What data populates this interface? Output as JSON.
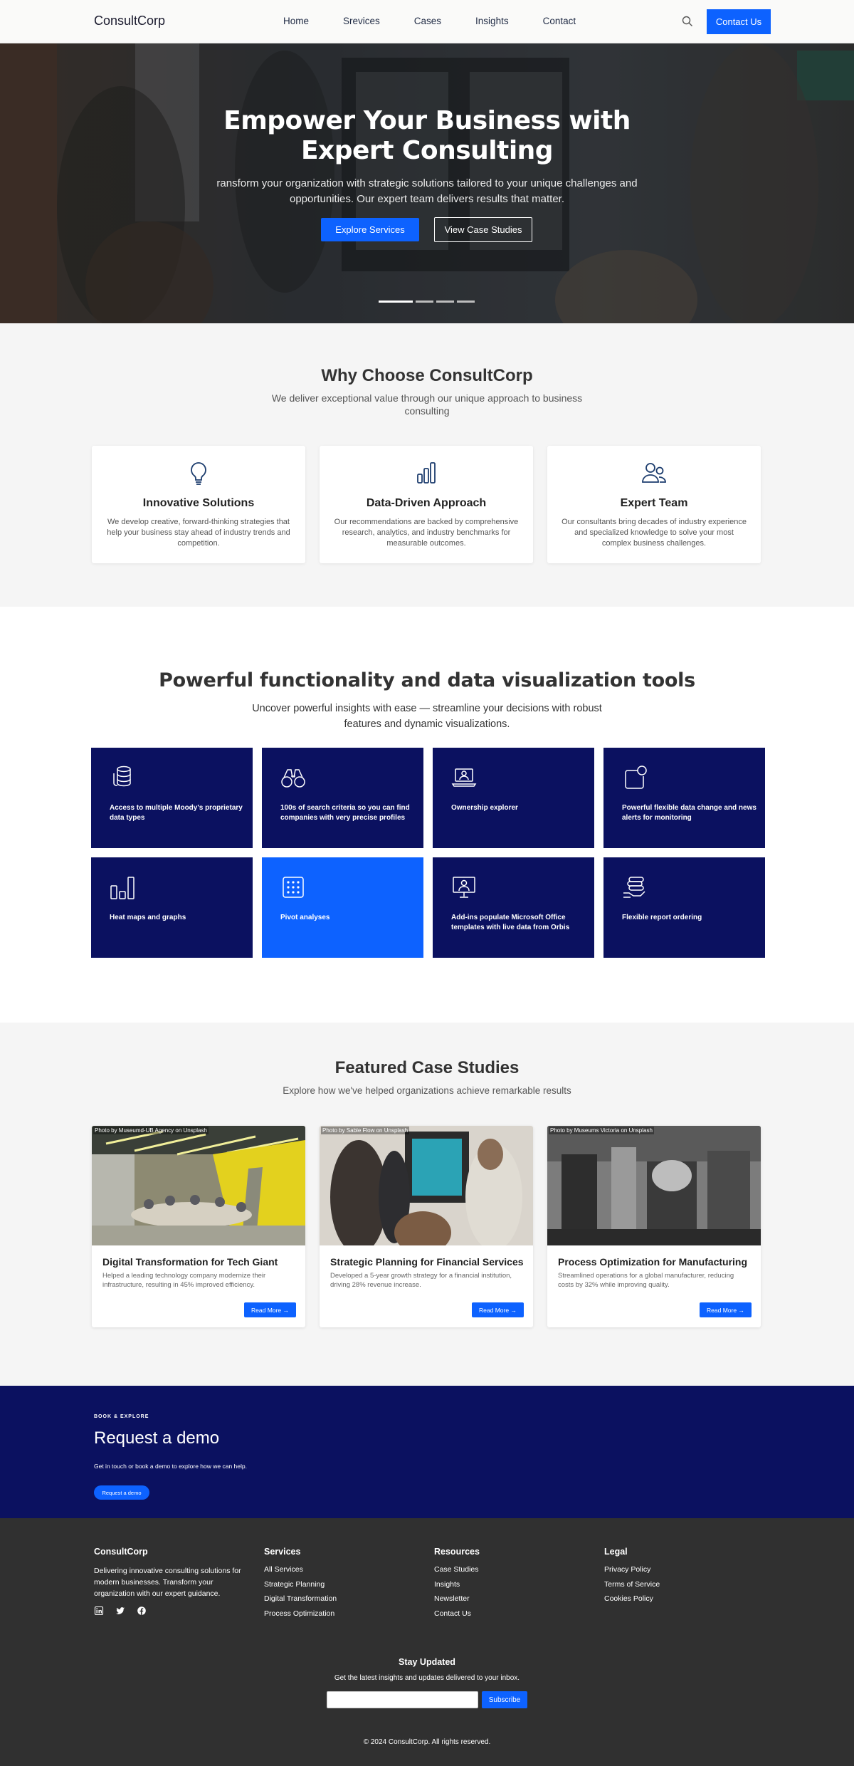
{
  "header": {
    "logo": "ConsultCorp",
    "nav": [
      "Home",
      "Srevices",
      "Cases",
      "Insights",
      "Contact"
    ],
    "contact_button": "Contact Us"
  },
  "hero": {
    "title": "Empower Your Business with Expert Consulting",
    "subtitle": "ransform your organization with strategic solutions tailored to your unique challenges and opportunities. Our expert team delivers results that matter.",
    "primary_button": "Explore Services",
    "secondary_button": "View Case Studies",
    "slides": 4,
    "active_slide": 1
  },
  "why": {
    "title": "Why Choose ConsultCorp",
    "subtitle": "We deliver exceptional value through our unique approach to business consulting",
    "cards": [
      {
        "icon": "lightbulb-icon",
        "title": "Innovative Solutions",
        "text": "We develop creative, forward-thinking strategies that help your business stay ahead of industry trends and competition."
      },
      {
        "icon": "bar-chart-icon",
        "title": "Data-Driven Approach",
        "text": "Our recommendations are backed by comprehensive research, analytics, and industry benchmarks for measurable outcomes."
      },
      {
        "icon": "team-icon",
        "title": "Expert Team",
        "text": "Our consultants bring decades of industry experience and specialized knowledge to solve your most complex business challenges."
      }
    ]
  },
  "functionality": {
    "title": "Powerful functionality and data visualization tools",
    "subtitle": "Uncover powerful insights with ease — streamline your decisions with robust features and dynamic visualizations.",
    "tiles": [
      {
        "icon": "database-icon",
        "label": "Access to multiple Moody's proprietary data types"
      },
      {
        "icon": "binoculars-icon",
        "label": "100s of search criteria so you can find companies with very precise profiles"
      },
      {
        "icon": "laptop-user-icon",
        "label": "Ownership explorer"
      },
      {
        "icon": "notification-icon",
        "label": "Powerful flexible data change and news alerts for monitoring"
      },
      {
        "icon": "bar-graph-icon",
        "label": "Heat maps and graphs"
      },
      {
        "icon": "calculator-icon",
        "label": "Pivot analyses"
      },
      {
        "icon": "monitor-user-icon",
        "label": "Add-ins populate Microsoft Office templates with live data from Orbis"
      },
      {
        "icon": "stacked-coins-icon",
        "label": "Flexible report ordering"
      }
    ],
    "colors": {
      "tile": "#0b1160",
      "highlight": "#0d62ff"
    }
  },
  "cases": {
    "title": "Featured Case Studies",
    "subtitle": "Explore how we've helped organizations achieve remarkable results",
    "read_more": "Read More",
    "items": [
      {
        "credit": "Photo by Museumd-UB Agency on Unsplash",
        "title": "Digital Transformation for Tech Giant",
        "text": "Helped a leading technology company modernize their infrastructure, resulting in 45% improved efficiency."
      },
      {
        "credit": "Photo by Sable Flow on Unsplash",
        "title": "Strategic Planning for Financial Services",
        "text": "Developed a 5-year growth strategy for a financial institution, driving 28% revenue increase."
      },
      {
        "credit": "Photo by Museums Victoria on Unsplash",
        "title": "Process Optimization for Manufacturing",
        "text": "Streamlined operations for a global manufacturer, reducing costs by 32% while improving quality."
      }
    ]
  },
  "demo": {
    "eyebrow": "BOOK & EXPLORE",
    "title": "Request a demo",
    "text": "Get in touch or book a demo to explore how we can help.",
    "button": "Request a demo"
  },
  "footer": {
    "about_title": "ConsultCorp",
    "about_text": "Delivering innovative consulting solutions for modern businesses. Transform your organization with our expert guidance.",
    "social": [
      "linkedin-icon",
      "twitter-icon",
      "facebook-icon"
    ],
    "columns": [
      {
        "title": "Services",
        "links": [
          "All Services",
          "Strategic Planning",
          "Digital Transformation",
          "Process Optimization"
        ]
      },
      {
        "title": "Resources",
        "links": [
          "Case Studies",
          "Insights",
          "Newsletter",
          "Contact Us"
        ]
      },
      {
        "title": "Legal",
        "links": [
          "Privacy Policy",
          "Terms of Service",
          "Cookies Policy"
        ]
      }
    ],
    "newsletter_title": "Stay Updated",
    "newsletter_text": "Get the latest insights and updates delivered to your inbox.",
    "newsletter_value": "",
    "subscribe": "Subscribe",
    "copyright": "© 2024 ConsultCorp. All rights reserved."
  }
}
